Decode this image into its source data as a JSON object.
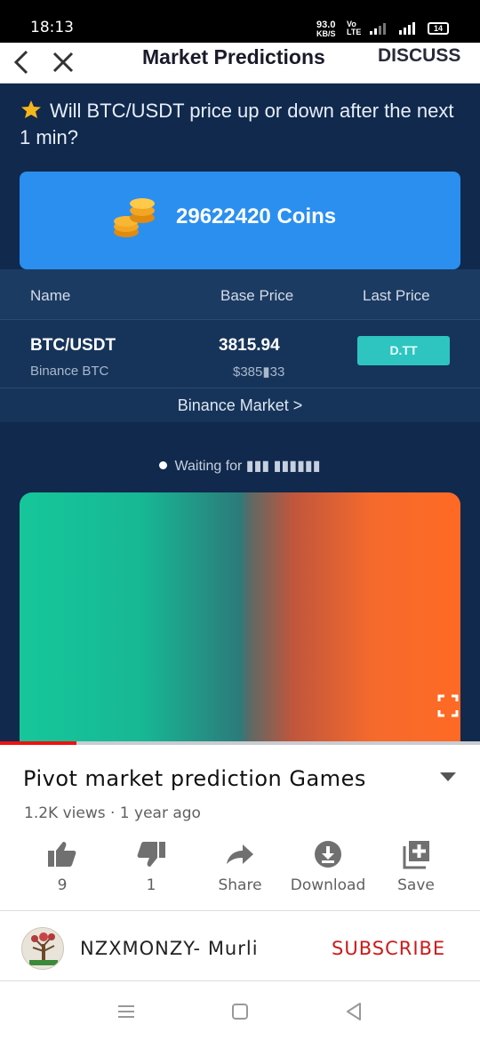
{
  "status_bar": {
    "time": "18:13",
    "speed_value": "93.0",
    "speed_unit": "KB/S",
    "volte_top": "Vo",
    "volte_bottom": "LTE",
    "battery": "14"
  },
  "app": {
    "title": "Market Predictions",
    "discuss_label": "DISCUSS",
    "question": "Will BTC/USDT price up or down after the next 1 min?",
    "coins": "29622420 Coins",
    "table": {
      "headers": [
        "Name",
        "Base Price",
        "Last Price"
      ],
      "pair": "BTC/USDT",
      "exchange": "Binance BTC",
      "base_price": "3815.94",
      "base_price_usd": "$385▮33",
      "last_price": "D.TT"
    },
    "market_link": "Binance Market >",
    "waiting_text": "Waiting for ▮▮▮ ▮▮▮▮▮▮"
  },
  "player": {
    "progress": 0.16
  },
  "video": {
    "title": "Pivot market prediction Games",
    "meta": "1.2K views · 1 year ago",
    "actions": [
      {
        "icon": "thumbs-up-icon",
        "label": "9"
      },
      {
        "icon": "thumbs-down-icon",
        "label": "1"
      },
      {
        "icon": "share-icon",
        "label": "Share"
      },
      {
        "icon": "download-icon",
        "label": "Download"
      },
      {
        "icon": "save-icon",
        "label": "Save"
      }
    ]
  },
  "channel": {
    "name": "NZXMONZY- Murli",
    "subscribe_label": "SUBSCRIBE"
  },
  "colors": {
    "subscribe": "#cc1a1a",
    "progress": "#ee1111",
    "app_background": "#10294d",
    "coins_card": "#2b8ff0",
    "up_color": "#16c79a",
    "down_color": "#ff6a25"
  }
}
